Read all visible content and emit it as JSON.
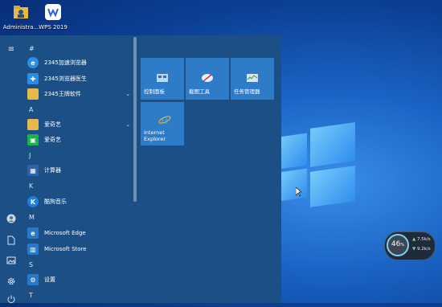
{
  "desktop": {
    "icons": [
      {
        "label": "Administra...",
        "icon": "user-folder-icon"
      },
      {
        "label": "WPS 2019",
        "icon": "wps-icon"
      }
    ]
  },
  "start_menu": {
    "rail": {
      "hamburger": "≡"
    },
    "groups": [
      {
        "letter": "#"
      },
      {
        "letter": "A"
      },
      {
        "letter": "J"
      },
      {
        "letter": "K"
      },
      {
        "letter": "M"
      },
      {
        "letter": "S"
      },
      {
        "letter": "T"
      }
    ],
    "apps": [
      {
        "label": "2345加速浏览器"
      },
      {
        "label": "2345浏览器医生"
      },
      {
        "label": "2345王牌软件",
        "chevron": "⌄"
      },
      {
        "label": "爱奇艺",
        "chevron": "⌄"
      },
      {
        "label": "爱奇艺"
      },
      {
        "label": "计算器"
      },
      {
        "label": "酷狗音乐"
      },
      {
        "label": "Microsoft Edge"
      },
      {
        "label": "Microsoft Store"
      },
      {
        "label": "设置"
      }
    ],
    "tiles": [
      {
        "label": "控制面板",
        "icon": "control-panel-icon"
      },
      {
        "label": "截图工具",
        "icon": "snipping-tool-icon"
      },
      {
        "label": "任务管理器",
        "icon": "task-manager-icon"
      },
      {
        "label": "Internet Explorer",
        "icon": "internet-explorer-icon"
      }
    ],
    "ie_line1": "Internet",
    "ie_line2": "Explorer"
  },
  "widget": {
    "cpu": "46",
    "cpu_unit": "%",
    "upload": "7.5",
    "download": "9.2",
    "speed_unit": "k/s"
  }
}
